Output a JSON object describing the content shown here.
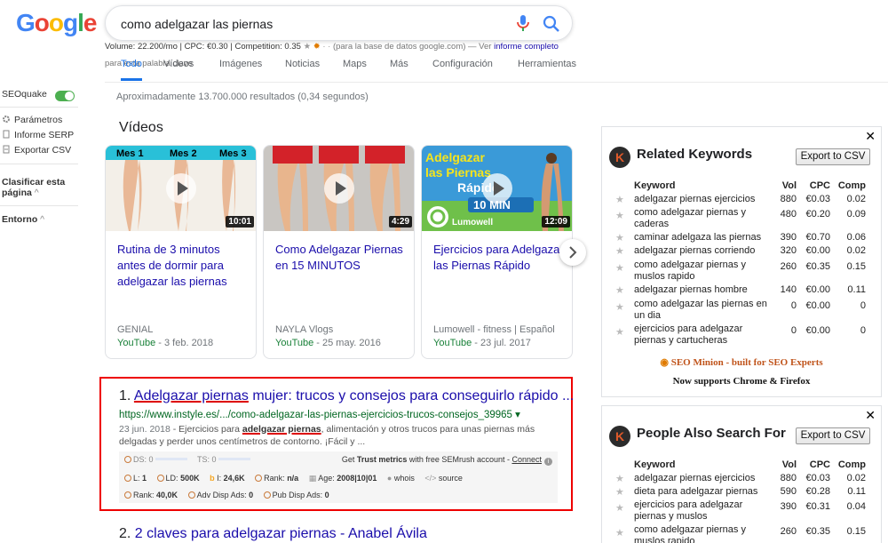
{
  "logo": [
    "G",
    "o",
    "o",
    "g",
    "l",
    "e"
  ],
  "search": {
    "value": "como adelgazar las piernas"
  },
  "seo_bar": {
    "volume": "Volume: 22.200/mo | CPC: €0.30 | Competition: 0.35",
    "db_note": "(para la base de datos google.com) — Ver",
    "link": "informe completo",
    "line2": "para esta palabra clave"
  },
  "tabs": [
    "Todo",
    "Vídeos",
    "Imágenes",
    "Noticias",
    "Maps",
    "Más",
    "Configuración",
    "Herramientas"
  ],
  "sidebar": {
    "title": "SEOquake",
    "items": [
      "Parámetros",
      "Informe SERP",
      "Exportar CSV"
    ],
    "sort": "Clasificar esta página",
    "env": "Entorno"
  },
  "stats": "Aproximadamente 13.700.000 resultados (0,34 segundos)",
  "videos_heading": "Vídeos",
  "videos": [
    {
      "thumb_labels": [
        "Mes 1",
        "Mes 2",
        "Mes 3"
      ],
      "duration": "10:01",
      "title": "Rutina de 3 minutos antes de dormir para adelgazar las piernas",
      "source": "GENIAL",
      "platform": "YouTube",
      "date": " - 3 feb. 2018"
    },
    {
      "duration": "4:29",
      "title": "Como Adelgazar Piernas en 15 MINUTOS",
      "source": "NAYLA Vlogs",
      "platform": "YouTube",
      "date": " - 25 may. 2016"
    },
    {
      "thumb_labels": [
        "Adelgazar",
        "las Piernas",
        "Rápido",
        "10 MIN",
        "Lumowell"
      ],
      "duration": "12:09",
      "title": "Ejercicios para Adelgazar las Piernas Rápido",
      "source": "Lumowell - fitness | Español",
      "platform": "YouTube",
      "date": " - 23 jul. 2017"
    }
  ],
  "result1": {
    "num": "1.",
    "title_link": "Adelgazar piernas",
    "title_rest": " mujer: trucos y consejos para conseguirlo rápido ...",
    "url": "https://www.instyle.es/.../como-adelgazar-las-piernas-ejercicios-trucos-consejos_39965 ▾",
    "date": "23 jun. 2018",
    "snippet_a": " - Ejercicios para ",
    "snippet_b": "adelgazar piernas",
    "snippet_c": ", alimentación y otros trucos para unas piernas más delgadas y perder unos centímetros de contorno. ¡Fácil y ...",
    "metrics": {
      "ds": "DS: 0",
      "ts": "TS: 0",
      "trust_a": "Get ",
      "trust_b": "Trust metrics",
      "trust_c": " with free SEMrush account - ",
      "connect": "Connect",
      "l": "L: ",
      "l_v": "1",
      "ld": "LD: ",
      "ld_v": "500K",
      "i": "I: ",
      "i_v": "24,6K",
      "rank": "Rank: ",
      "rank_v": "n/a",
      "age": "Age: ",
      "age_v": "2008|10|01",
      "whois": "whois",
      "source": "source",
      "rank2": "Rank: ",
      "rank2_v": "40,0K",
      "adv": "Adv Disp Ads: ",
      "adv_v": "0",
      "pub": "Pub Disp Ads: ",
      "pub_v": "0"
    }
  },
  "result2": {
    "num": "2.",
    "title": "2 claves para adelgazar piernas - Anabel Ávila"
  },
  "related": {
    "title": "Related Keywords",
    "export": "Export to CSV",
    "headers": [
      "Keyword",
      "Vol",
      "CPC",
      "Comp"
    ],
    "rows": [
      [
        "adelgazar piernas ejercicios",
        "880",
        "€0.03",
        "0.02"
      ],
      [
        "como adelgazar piernas y caderas",
        "480",
        "€0.20",
        "0.09"
      ],
      [
        "caminar adelgaza las piernas",
        "390",
        "€0.70",
        "0.06"
      ],
      [
        "adelgazar piernas corriendo",
        "320",
        "€0.00",
        "0.02"
      ],
      [
        "como adelgazar piernas y muslos rapido",
        "260",
        "€0.35",
        "0.15"
      ],
      [
        "adelgazar piernas hombre",
        "140",
        "€0.00",
        "0.11"
      ],
      [
        "como adelgazar las piernas en un dia",
        "0",
        "€0.00",
        "0"
      ],
      [
        "ejercicios para adelgazar piernas y cartucheras",
        "0",
        "€0.00",
        "0"
      ]
    ],
    "promo1": "SEO Minion - built for SEO Experts",
    "promo2": "Now supports Chrome & Firefox"
  },
  "people": {
    "title": "People Also Search For",
    "export": "Export to CSV",
    "headers": [
      "Keyword",
      "Vol",
      "CPC",
      "Comp"
    ],
    "rows": [
      [
        "adelgazar piernas ejercicios",
        "880",
        "€0.03",
        "0.02"
      ],
      [
        "dieta para adelgazar piernas",
        "590",
        "€0.28",
        "0.11"
      ],
      [
        "ejercicios para adelgazar piernas y muslos",
        "390",
        "€0.31",
        "0.04"
      ],
      [
        "como adelgazar piernas y muslos rapido",
        "260",
        "€0.35",
        "0.15"
      ]
    ]
  },
  "colors": {
    "link": "#1a0dab",
    "url_green": "#006621",
    "accent_blue": "#1a73e8",
    "highlight_red": "#e00"
  }
}
